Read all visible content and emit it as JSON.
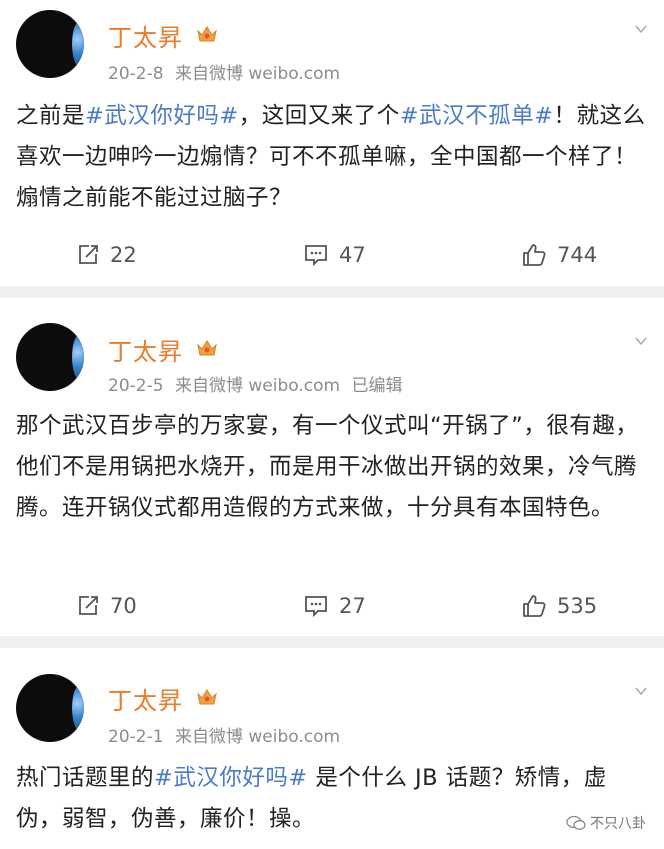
{
  "posts": [
    {
      "author": "丁太昇",
      "date": "20-2-8",
      "source": "来自微博 weibo.com",
      "edited": "",
      "text_parts": [
        {
          "t": "之前是",
          "tag": false
        },
        {
          "t": "#武汉你好吗#",
          "tag": true
        },
        {
          "t": "，这回又来了个",
          "tag": false
        },
        {
          "t": "#武汉不孤单#",
          "tag": true
        },
        {
          "t": "！就这么喜欢一边呻吟一边煽情？可不不孤单嘛，全中国都一个样了！煽情之前能不能过过脑子？",
          "tag": false
        }
      ],
      "reposts": "22",
      "comments": "47",
      "likes": "744"
    },
    {
      "author": "丁太昇",
      "date": "20-2-5",
      "source": "来自微博 weibo.com",
      "edited": "已编辑",
      "text_parts": [
        {
          "t": "那个武汉百步亭的万家宴，有一个仪式叫“开锅了”，很有趣，他们不是用锅把水烧开，而是用干冰做出开锅的效果，冷气腾腾。连开锅仪式都用造假的方式来做，十分具有本国特色。",
          "tag": false
        }
      ],
      "reposts": "70",
      "comments": "27",
      "likes": "535"
    },
    {
      "author": "丁太昇",
      "date": "20-2-1",
      "source": "来自微博 weibo.com",
      "edited": "",
      "text_parts": [
        {
          "t": "热门话题里的",
          "tag": false
        },
        {
          "t": "#武汉你好吗#",
          "tag": true
        },
        {
          "t": " 是个什么 JB 话题？矫情，虚伪，弱智，伪善，廉价！操。",
          "tag": false
        }
      ]
    }
  ],
  "watermark": "不只八卦",
  "colors": {
    "author": "#ea7b2b",
    "hashtag": "#4a7bc8",
    "meta": "#8c8c8c",
    "background": "#efefef"
  },
  "icons": [
    "repost-icon",
    "comment-icon",
    "like-icon",
    "chevron-down-icon",
    "vip-crown-icon",
    "wechat-icon"
  ]
}
